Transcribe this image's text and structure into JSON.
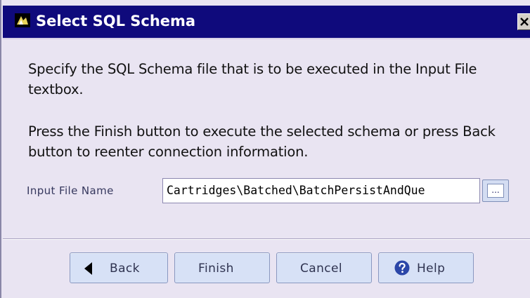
{
  "window": {
    "title": "Select SQL Schema"
  },
  "content": {
    "instruction_1": "Specify the SQL Schema file that is to be executed in the Input File textbox.",
    "instruction_2": "Press the Finish button to execute the selected schema or press Back button to reenter connection information."
  },
  "input_file": {
    "label": "Input File Name",
    "value": "Cartridges\\Batched\\BatchPersistAndQue",
    "browse_label": "..."
  },
  "buttons": {
    "back": "Back",
    "finish": "Finish",
    "cancel": "Cancel",
    "help": "Help"
  },
  "icons": {
    "app": "app-logo-icon",
    "close": "close-icon",
    "back": "arrow-left-icon",
    "help": "question-circle-icon"
  },
  "colors": {
    "titlebar": "#0f0a7c",
    "background": "#e9e4f2",
    "button_face": "#d7e1f6",
    "help_icon": "#2b46a8"
  }
}
